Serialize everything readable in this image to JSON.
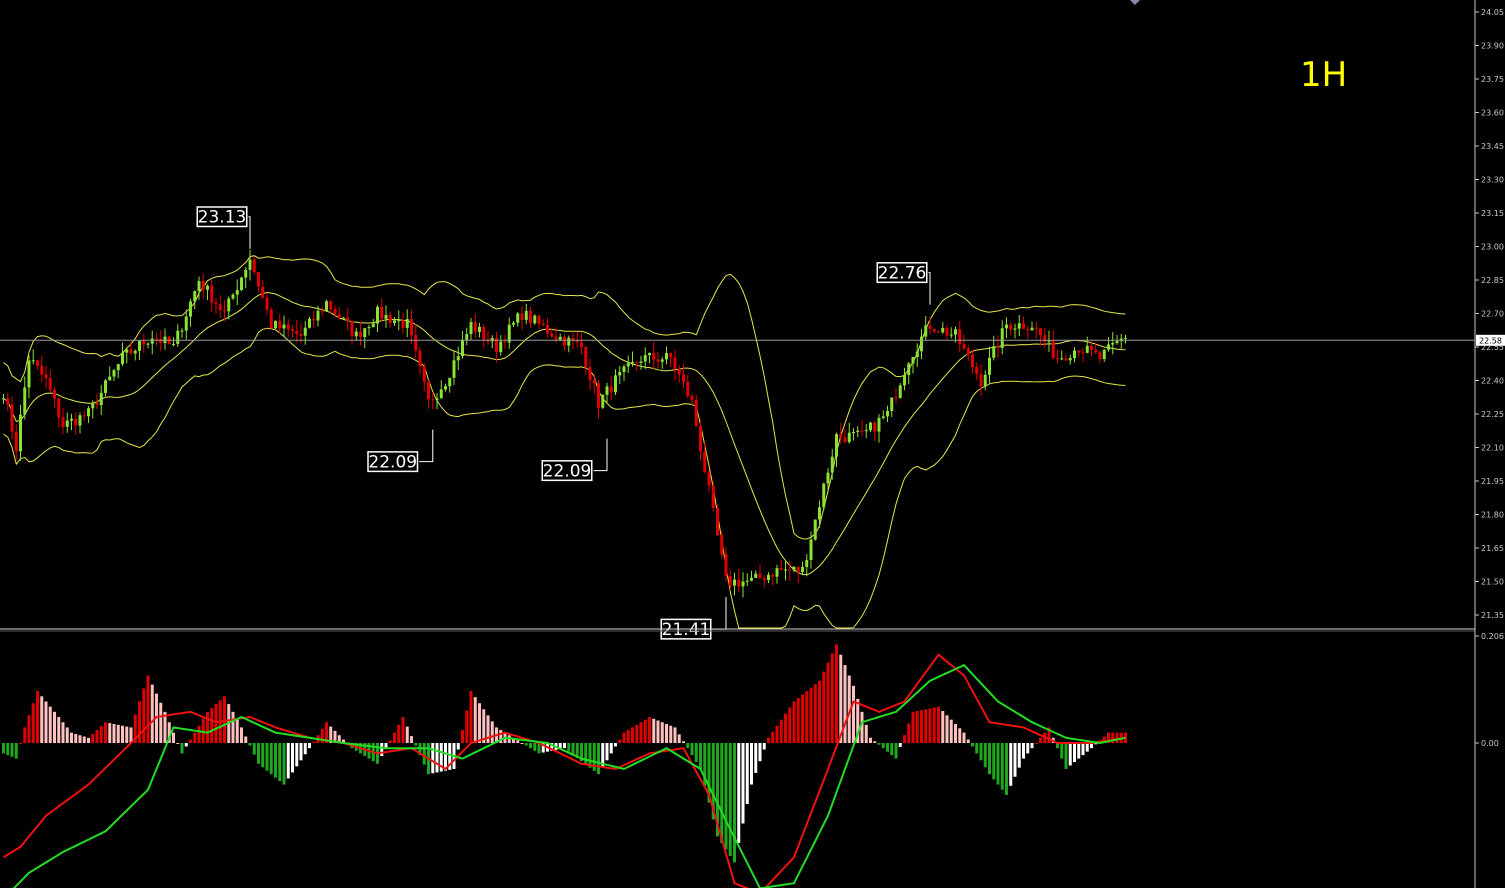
{
  "colors": {
    "background": "#000000",
    "bull": "#8ae234",
    "bear": "#e00000",
    "bands": "#e6e64c",
    "label_bg": "#ffffff",
    "label_fg": "#000000",
    "axis": "#c8c8c8",
    "timeframe": "#ffff00",
    "hist_pos_strong": "#e00000",
    "hist_pos_weak": "#ffc0c0",
    "hist_neg_strong": "#1fa81f",
    "hist_neg_weak": "#ffffff",
    "macd_line": "#ee1111",
    "signal_line": "#22dd22"
  },
  "timeframe": "1H",
  "current_price": "22.58",
  "chart_data": [
    {
      "type": "candlestick",
      "price_axis": {
        "ticks": [
          "24.05",
          "23.90",
          "23.75",
          "23.60",
          "23.45",
          "23.30",
          "23.15",
          "23.00",
          "22.85",
          "22.70",
          "22.55",
          "22.40",
          "22.25",
          "22.10",
          "21.95",
          "21.80",
          "21.65",
          "21.50",
          "21.35"
        ],
        "range": [
          21.3,
          24.07
        ]
      },
      "annotations": [
        {
          "text": "23.13",
          "bar": 58,
          "price": 22.99,
          "side": "above"
        },
        {
          "text": "22.09",
          "bar": 101,
          "price": 22.18,
          "side": "below"
        },
        {
          "text": "22.09",
          "bar": 142,
          "price": 22.14,
          "side": "below"
        },
        {
          "text": "21.41",
          "bar": 170,
          "price": 21.43,
          "side": "below"
        },
        {
          "text": "22.76",
          "bar": 218,
          "price": 22.74,
          "side": "above"
        }
      ],
      "bars": 265,
      "bands": "bollinger"
    },
    {
      "type": "bar",
      "indicator": "MACD",
      "value_axis": {
        "ticks": [
          "0.2061",
          "0.00"
        ],
        "range": [
          -0.32,
          0.2061
        ]
      },
      "series_types": [
        "histogram",
        "macd",
        "signal"
      ]
    }
  ]
}
